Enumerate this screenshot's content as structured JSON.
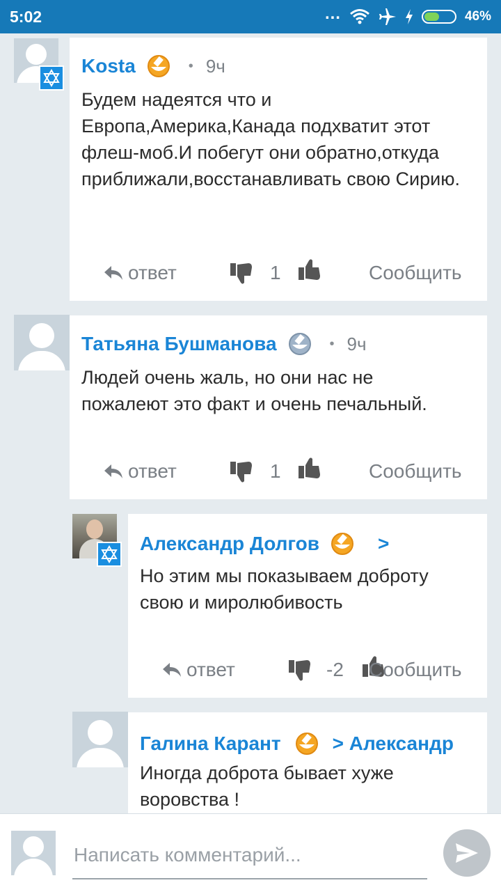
{
  "status": {
    "time": "5:02",
    "dots": "...",
    "battery": "46%",
    "icons": [
      "wifi-icon",
      "airplane-icon",
      "charging-icon",
      "battery-icon"
    ]
  },
  "colors": {
    "status_bar": "#1679b8",
    "author": "#1a85d6",
    "background": "#e5ebef",
    "badge": "#1a8ee0"
  },
  "comments": [
    {
      "author": "Kosta",
      "medal": "gold-medal-icon",
      "dot": "•",
      "time": "9ч",
      "text": "Будем надеятся что и Европа,Америка,Канада подхватит этот флеш-моб.И побегут они обратно,откуда приближали,восстанавливать свою Сирию.",
      "reply_label": "ответ",
      "votes": "1",
      "report_label": "Сообщить",
      "badge": "star-of-david-icon"
    },
    {
      "author": "Татьяна Бушманова",
      "medal": "silver-medal-icon",
      "dot": "•",
      "time": "9ч",
      "text": "Людей очень жаль, но  они нас не пожалеют это факт и очень печальный.",
      "reply_label": "ответ",
      "votes": "1",
      "report_label": "Сообщить"
    },
    {
      "author": "Александр Долгов",
      "medal": "gold-medal-icon",
      "reply_arrow": ">",
      "text": "Но этим мы показываем доброту свою и миролюбивость",
      "reply_label": "ответ",
      "votes": "-2",
      "report_label": "Сообщить",
      "badge": "star-of-david-icon"
    },
    {
      "author": "Галина Карант",
      "medal": "gold-medal-icon",
      "reply_to": "> Александр",
      "text": "Иногда доброта бывает хуже воровства !"
    }
  ],
  "composer": {
    "placeholder": "Написать комментарий...",
    "send_icon": "send-icon"
  }
}
